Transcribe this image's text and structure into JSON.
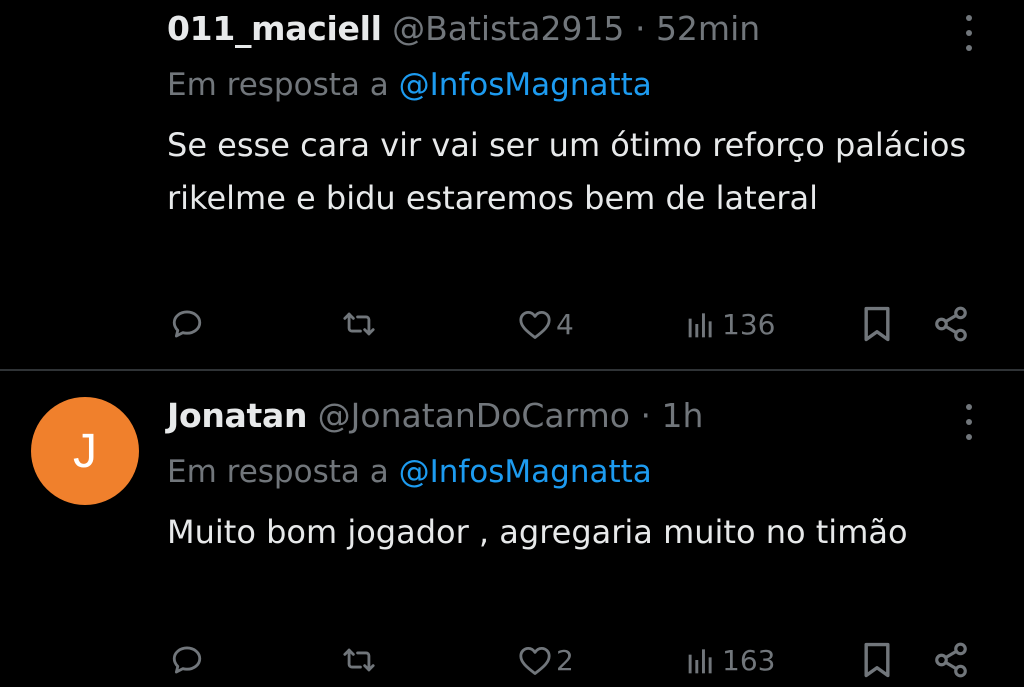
{
  "tweets": [
    {
      "display_name": "011_maciell",
      "handle": "@Batista2915",
      "separator": "·",
      "time": "52min",
      "reply_prefix": "Em resposta a",
      "reply_to": "@InfosMagnatta",
      "text": "Se esse cara vir vai ser um ótimo reforço palácios rikelme e bidu estaremos bem de lateral",
      "likes": "4",
      "views": "136",
      "avatar_letter": ""
    },
    {
      "display_name": "Jonatan",
      "handle": "@JonatanDoCarmo",
      "separator": "·",
      "time": "1h",
      "reply_prefix": "Em resposta a",
      "reply_to": "@InfosMagnatta",
      "text": "Muito bom jogador , agregaria muito no timão",
      "likes": "2",
      "views": "163",
      "avatar_letter": "J",
      "avatar_color": "#f0802c"
    }
  ],
  "icons": {
    "reply": "speech-bubble-icon",
    "retweet": "retweet-icon",
    "like": "heart-icon",
    "views": "bar-chart-icon",
    "bookmark": "bookmark-icon",
    "share": "share-icon",
    "more": "vertical-dots-icon"
  },
  "colors": {
    "background": "#000000",
    "text": "#e7e9ea",
    "muted": "#71767b",
    "link": "#1d9bf0",
    "divider": "#2f3336"
  }
}
